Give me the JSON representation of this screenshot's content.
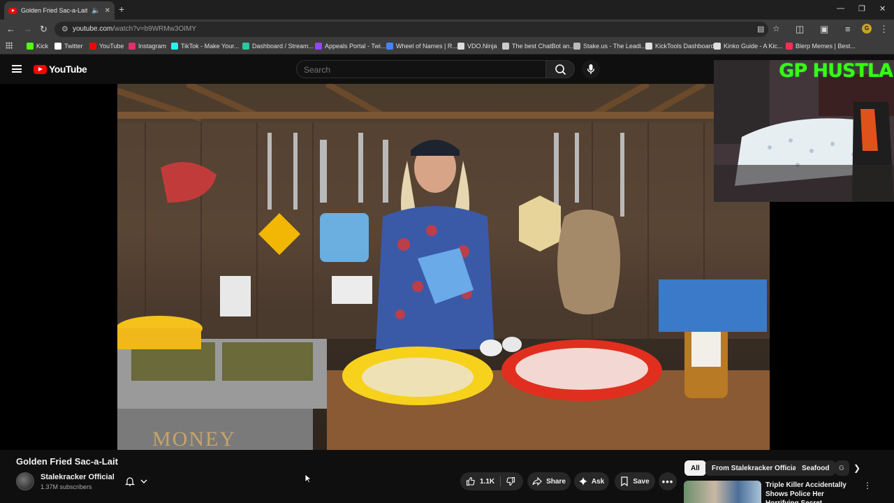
{
  "browser": {
    "tab_title": "Golden Fried Sac-a-Lait - Yo",
    "new_tab_icon": "plus-icon",
    "url_host": "youtube.com",
    "url_path": "/watch?v=b9WRMw3OIMY",
    "profile_initial": "G",
    "bookmarks": [
      {
        "label": "Kick",
        "color": "#53fc18"
      },
      {
        "label": "Twitter",
        "color": "#ffffff"
      },
      {
        "label": "YouTube",
        "color": "#ff0000"
      },
      {
        "label": "Instagram",
        "color": "#e1306c"
      },
      {
        "label": "TikTok - Make Your...",
        "color": "#25f4ee"
      },
      {
        "label": "Dashboard / Stream...",
        "color": "#2cc8a0"
      },
      {
        "label": "Appeals Portal - Twi...",
        "color": "#9146ff"
      },
      {
        "label": "Wheel of Names | R...",
        "color": "#4285f4"
      },
      {
        "label": "VDO.Ninja",
        "color": "#dddddd"
      },
      {
        "label": "The best ChatBot an...",
        "color": "#cccccc"
      },
      {
        "label": "Stake.us - The Leadi...",
        "color": "#bbbbbb"
      },
      {
        "label": "KickTools Dashboard",
        "color": "#e0e0e0"
      },
      {
        "label": "Kinko Guide - A Kic...",
        "color": "#e0e0e0"
      },
      {
        "label": "Blerp Memes | Best...",
        "color": "#ff2d55"
      }
    ]
  },
  "youtube": {
    "logo_text": "YouTube",
    "search_placeholder": "Search"
  },
  "video": {
    "title": "Golden Fried Sac-a-Lait",
    "overlay_text": "GP HUSTLA"
  },
  "channel": {
    "name": "Stalekracker Official",
    "subscribers": "1.37M subscribers"
  },
  "actions": {
    "likes": "1.1K",
    "share": "Share",
    "ask": "Ask",
    "save": "Save"
  },
  "chips": [
    "All",
    "From Stalekracker Official",
    "Seafood",
    "G"
  ],
  "recommendation": {
    "title": "Triple Killer Accidentally Shows Police Her Horrifying Secret"
  },
  "colors": {
    "youtube_red": "#ff0000",
    "overlay_green": "#39ff14",
    "background": "#0f0f0f"
  }
}
